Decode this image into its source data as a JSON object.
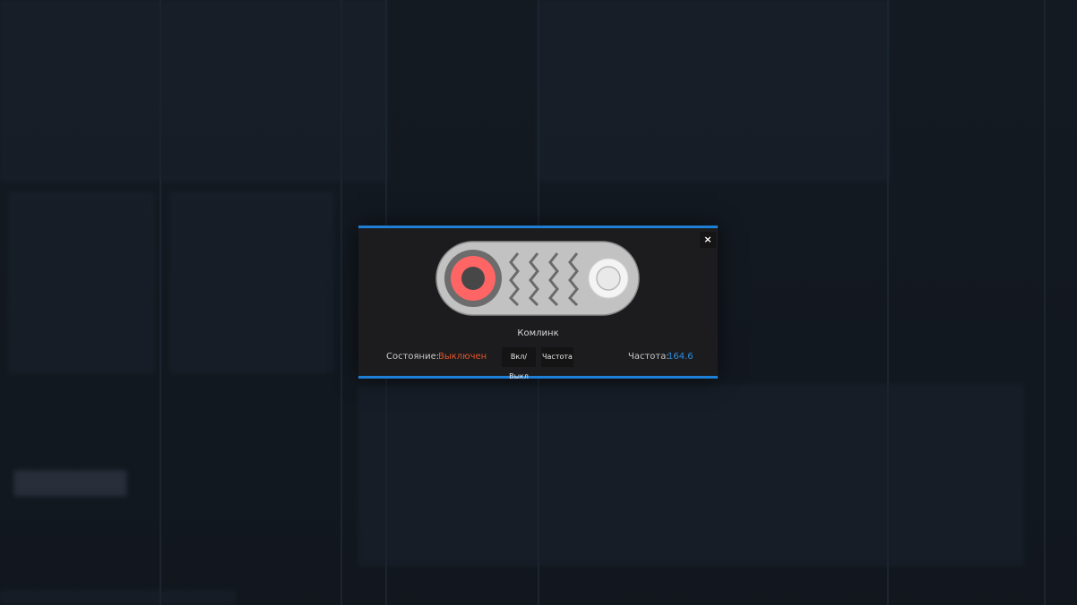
{
  "modal": {
    "title": "Комлинк",
    "close_label": "×",
    "status": {
      "label": "Состояние:",
      "value": "Выключен",
      "value_color": "#e4552c"
    },
    "buttons": {
      "power_label": "Вкл/Выкл",
      "frequency_label": "Частота"
    },
    "frequency": {
      "label": "Частота:",
      "value": "164.6",
      "value_color": "#2d8ee0"
    },
    "accent_color": "#1e7fd6",
    "device_icon": "comlink-radio-icon"
  }
}
